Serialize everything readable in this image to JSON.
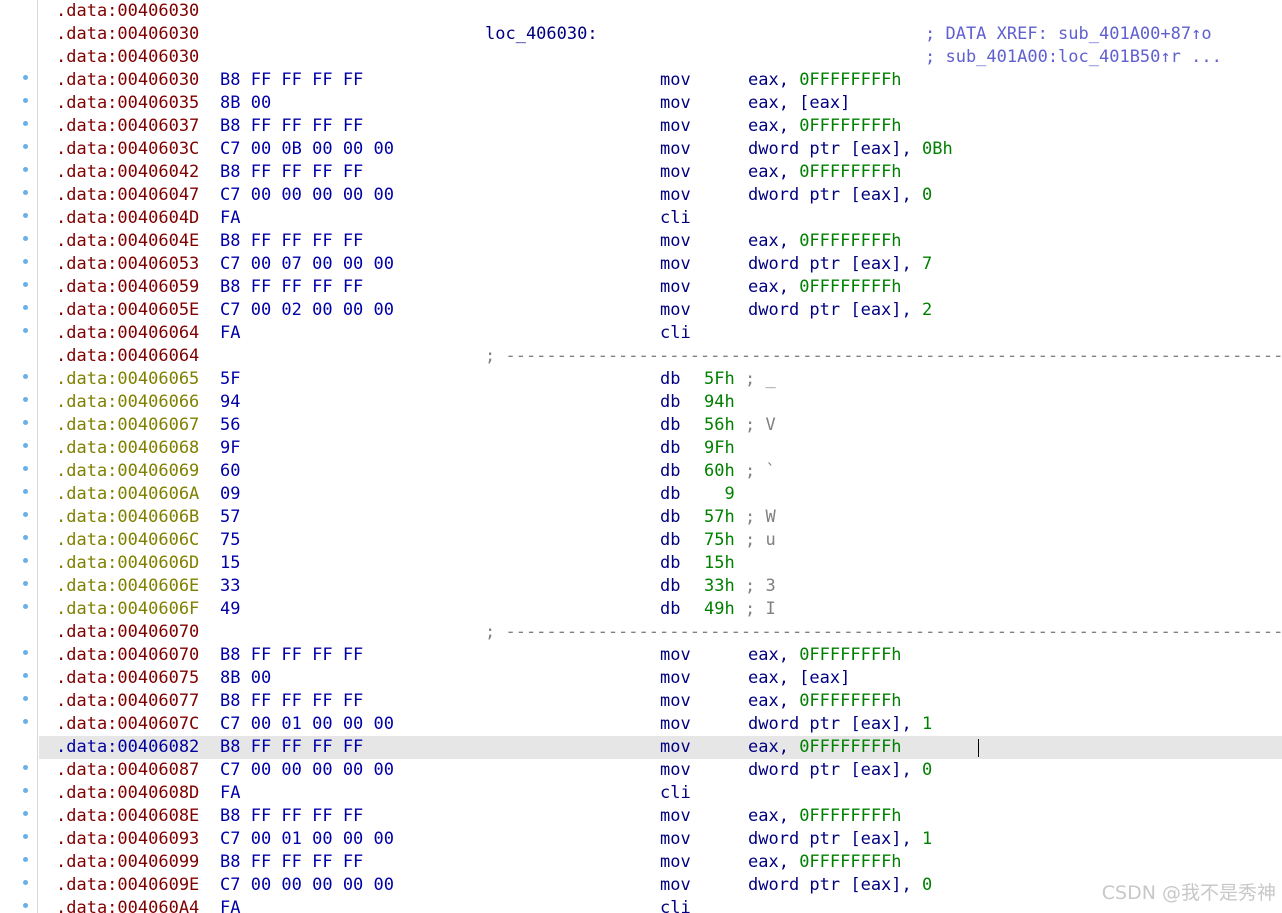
{
  "listing": [
    {
      "addr": ".data:00406030",
      "bytes": "",
      "label": "",
      "mnem": "",
      "ops": "",
      "xref": ""
    },
    {
      "addr": ".data:00406030",
      "bytes": "",
      "label": "loc_406030:",
      "mnem": "",
      "ops": "",
      "xref": "; DATA XREF: sub_401A00+87↑o"
    },
    {
      "addr": ".data:00406030",
      "bytes": "",
      "label": "",
      "mnem": "",
      "ops": "",
      "xref": "; sub_401A00:loc_401B50↑r ..."
    },
    {
      "addr": ".data:00406030",
      "bytes": "B8 FF FF FF FF",
      "mnem": "mov",
      "op_a": "eax, ",
      "op_n": "0FFFFFFFFh",
      "dot": true
    },
    {
      "addr": ".data:00406035",
      "bytes": "8B 00",
      "mnem": "mov",
      "op_a": "eax, [eax]",
      "op_n": "",
      "dot": true
    },
    {
      "addr": ".data:00406037",
      "bytes": "B8 FF FF FF FF",
      "mnem": "mov",
      "op_a": "eax, ",
      "op_n": "0FFFFFFFFh",
      "dot": true
    },
    {
      "addr": ".data:0040603C",
      "bytes": "C7 00 0B 00 00 00",
      "mnem": "mov",
      "op_a": "dword ptr [eax], ",
      "op_n": "0Bh",
      "dot": true
    },
    {
      "addr": ".data:00406042",
      "bytes": "B8 FF FF FF FF",
      "mnem": "mov",
      "op_a": "eax, ",
      "op_n": "0FFFFFFFFh",
      "dot": true
    },
    {
      "addr": ".data:00406047",
      "bytes": "C7 00 00 00 00 00",
      "mnem": "mov",
      "op_a": "dword ptr [eax], ",
      "op_n": "0",
      "dot": true
    },
    {
      "addr": ".data:0040604D",
      "bytes": "FA",
      "mnem": "cli",
      "op_a": "",
      "op_n": "",
      "dot": true
    },
    {
      "addr": ".data:0040604E",
      "bytes": "B8 FF FF FF FF",
      "mnem": "mov",
      "op_a": "eax, ",
      "op_n": "0FFFFFFFFh",
      "dot": true
    },
    {
      "addr": ".data:00406053",
      "bytes": "C7 00 07 00 00 00",
      "mnem": "mov",
      "op_a": "dword ptr [eax], ",
      "op_n": "7",
      "dot": true
    },
    {
      "addr": ".data:00406059",
      "bytes": "B8 FF FF FF FF",
      "mnem": "mov",
      "op_a": "eax, ",
      "op_n": "0FFFFFFFFh",
      "dot": true
    },
    {
      "addr": ".data:0040605E",
      "bytes": "C7 00 02 00 00 00",
      "mnem": "mov",
      "op_a": "dword ptr [eax], ",
      "op_n": "2",
      "dot": true
    },
    {
      "addr": ".data:00406064",
      "bytes": "FA",
      "mnem": "cli",
      "op_a": "",
      "op_n": "",
      "dot": true
    },
    {
      "addr": ".data:00406064",
      "sep": "; ---------------------------------------------------------------------------------------"
    },
    {
      "addr": ".data:00406065",
      "bytes": "5F",
      "db": "5Fh",
      "dbc": "; _",
      "olive": true,
      "dot": true
    },
    {
      "addr": ".data:00406066",
      "bytes": "94",
      "db": "94h",
      "dbc": "",
      "olive": true,
      "dot": true
    },
    {
      "addr": ".data:00406067",
      "bytes": "56",
      "db": "56h",
      "dbc": "; V",
      "olive": true,
      "dot": true
    },
    {
      "addr": ".data:00406068",
      "bytes": "9F",
      "db": "9Fh",
      "dbc": "",
      "olive": true,
      "dot": true
    },
    {
      "addr": ".data:00406069",
      "bytes": "60",
      "db": "60h",
      "dbc": "; `",
      "olive": true,
      "dot": true
    },
    {
      "addr": ".data:0040606A",
      "bytes": "09",
      "db": "  9",
      "dbc": "",
      "olive": true,
      "dot": true
    },
    {
      "addr": ".data:0040606B",
      "bytes": "57",
      "db": "57h",
      "dbc": "; W",
      "olive": true,
      "dot": true
    },
    {
      "addr": ".data:0040606C",
      "bytes": "75",
      "db": "75h",
      "dbc": "; u",
      "olive": true,
      "dot": true
    },
    {
      "addr": ".data:0040606D",
      "bytes": "15",
      "db": "15h",
      "dbc": "",
      "olive": true,
      "dot": true
    },
    {
      "addr": ".data:0040606E",
      "bytes": "33",
      "db": "33h",
      "dbc": "; 3",
      "olive": true,
      "dot": true
    },
    {
      "addr": ".data:0040606F",
      "bytes": "49",
      "db": "49h",
      "dbc": "; I",
      "olive": true,
      "dot": true
    },
    {
      "addr": ".data:00406070",
      "sep": "; ---------------------------------------------------------------------------------------"
    },
    {
      "addr": ".data:00406070",
      "bytes": "B8 FF FF FF FF",
      "mnem": "mov",
      "op_a": "eax, ",
      "op_n": "0FFFFFFFFh",
      "dot": true
    },
    {
      "addr": ".data:00406075",
      "bytes": "8B 00",
      "mnem": "mov",
      "op_a": "eax, [eax]",
      "op_n": "",
      "dot": true
    },
    {
      "addr": ".data:00406077",
      "bytes": "B8 FF FF FF FF",
      "mnem": "mov",
      "op_a": "eax, ",
      "op_n": "0FFFFFFFFh",
      "dot": true
    },
    {
      "addr": ".data:0040607C",
      "bytes": "C7 00 01 00 00 00",
      "mnem": "mov",
      "op_a": "dword ptr [eax], ",
      "op_n": "1",
      "dot": true
    },
    {
      "addr": ".data:00406082",
      "bytes": "B8 FF FF FF FF",
      "mnem": "mov",
      "op_a": "eax, ",
      "op_n": "0FFFFFFFFh",
      "dot": true,
      "selected": true
    },
    {
      "addr": ".data:00406087",
      "bytes": "C7 00 00 00 00 00",
      "mnem": "mov",
      "op_a": "dword ptr [eax], ",
      "op_n": "0",
      "dot": true
    },
    {
      "addr": ".data:0040608D",
      "bytes": "FA",
      "mnem": "cli",
      "op_a": "",
      "op_n": "",
      "dot": true
    },
    {
      "addr": ".data:0040608E",
      "bytes": "B8 FF FF FF FF",
      "mnem": "mov",
      "op_a": "eax, ",
      "op_n": "0FFFFFFFFh",
      "dot": true
    },
    {
      "addr": ".data:00406093",
      "bytes": "C7 00 01 00 00 00",
      "mnem": "mov",
      "op_a": "dword ptr [eax], ",
      "op_n": "1",
      "dot": true
    },
    {
      "addr": ".data:00406099",
      "bytes": "B8 FF FF FF FF",
      "mnem": "mov",
      "op_a": "eax, ",
      "op_n": "0FFFFFFFFh",
      "dot": true
    },
    {
      "addr": ".data:0040609E",
      "bytes": "C7 00 00 00 00 00",
      "mnem": "mov",
      "op_a": "dword ptr [eax], ",
      "op_n": "0",
      "dot": true
    },
    {
      "addr": ".data:004060A4",
      "bytes": "FA",
      "mnem": "cli",
      "op_a": "",
      "op_n": "",
      "dot": true
    }
  ],
  "watermark": "CSDN @我不是秀神",
  "colors": {
    "address": "#800000",
    "address_olive": "#808000",
    "bytes": "#0000a8",
    "mnemonic": "#000080",
    "number": "#008000",
    "xref": "#6060d0",
    "selection": "#e6e6e6",
    "gutter_dot": "#6ab0e8"
  }
}
